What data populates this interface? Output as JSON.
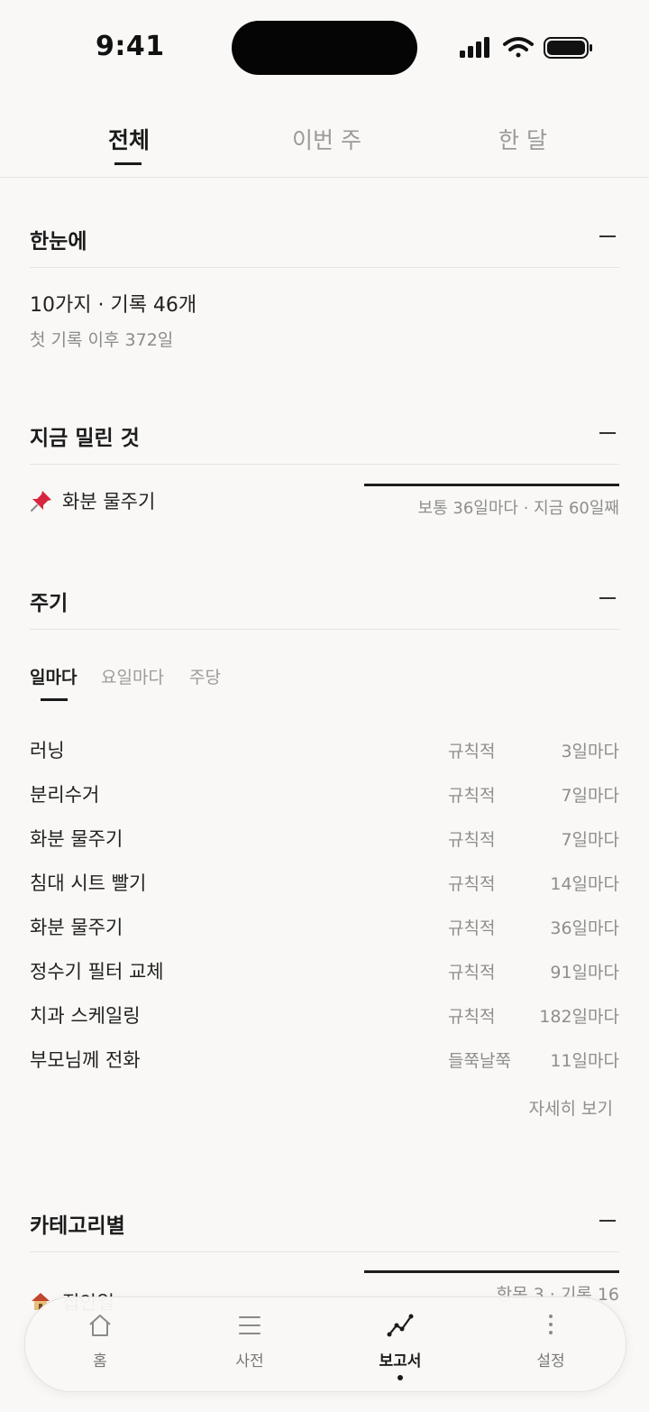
{
  "status_bar": {
    "time": "9:41"
  },
  "top_tabs": [
    {
      "label": "전체",
      "active": true
    },
    {
      "label": "이번 주",
      "active": false
    },
    {
      "label": "한 달",
      "active": false
    }
  ],
  "overview": {
    "title": "한눈에",
    "summary": "10가지 · 기록 46개",
    "since": "첫 기록 이후 372일"
  },
  "overdue": {
    "title": "지금 밀린 것",
    "items": [
      {
        "icon": "pushpin-icon",
        "name": "화분 물주기",
        "detail": "보통 36일마다 · 지금 60일째",
        "progress": 1.0
      }
    ]
  },
  "cycle": {
    "title": "주기",
    "tabs": [
      {
        "label": "일마다",
        "active": true
      },
      {
        "label": "요일마다",
        "active": false
      },
      {
        "label": "주당",
        "active": false
      }
    ],
    "rows": [
      {
        "name": "러닝",
        "kind": "규칙적",
        "freq": "3일마다"
      },
      {
        "name": "분리수거",
        "kind": "규칙적",
        "freq": "7일마다"
      },
      {
        "name": "화분 물주기",
        "kind": "규칙적",
        "freq": "7일마다"
      },
      {
        "name": "침대 시트 빨기",
        "kind": "규칙적",
        "freq": "14일마다"
      },
      {
        "name": "화분 물주기",
        "kind": "규칙적",
        "freq": "36일마다"
      },
      {
        "name": "정수기 필터 교체",
        "kind": "규칙적",
        "freq": "91일마다"
      },
      {
        "name": "치과 스케일링",
        "kind": "규칙적",
        "freq": "182일마다"
      },
      {
        "name": "부모님께 전화",
        "kind": "들쭉날쭉",
        "freq": "11일마다"
      }
    ],
    "more_label": "자세히 보기"
  },
  "category": {
    "title": "카테고리별",
    "items": [
      {
        "icon": "house-icon",
        "name": "집안일",
        "detail": "항목 3 · 기록 16"
      }
    ]
  },
  "bottom_nav": [
    {
      "label": "홈",
      "icon": "home-icon",
      "active": false
    },
    {
      "label": "사전",
      "icon": "list-icon",
      "active": false
    },
    {
      "label": "보고서",
      "icon": "chart-line-icon",
      "active": true
    },
    {
      "label": "설정",
      "icon": "more-vertical-icon",
      "active": false
    }
  ],
  "colors": {
    "background": "#f9f8f6",
    "text": "#1f1f1f",
    "muted": "#8e8e8e",
    "divider": "#e6e4e0"
  }
}
